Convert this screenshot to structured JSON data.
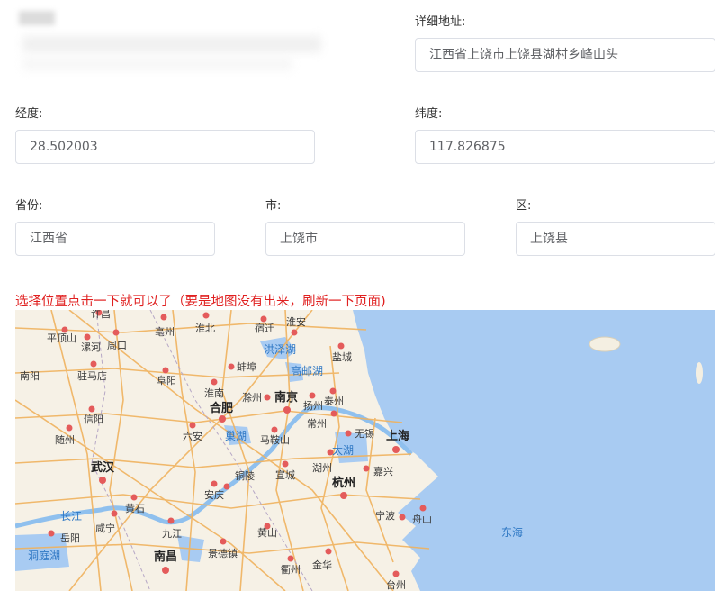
{
  "form": {
    "address_label": "详细地址:",
    "address_value": "江西省上饶市上饶县湖村乡峰山头",
    "lng_label": "经度:",
    "lng_value": "28.502003",
    "lat_label": "纬度:",
    "lat_value": "117.826875",
    "province_label": "省份:",
    "province_value": "江西省",
    "city_label": "市:",
    "city_value": "上饶市",
    "district_label": "区:",
    "district_value": "上饶县"
  },
  "hint": "选择位置点击一下就可以了（要是地图没有出来，刷新一下页面)",
  "map": {
    "cities": [
      "许昌",
      "亳州",
      "淮北",
      "宿迁",
      "淮安",
      "平顶山",
      "漯河",
      "周口",
      "盐城",
      "南阳",
      "驻马店",
      "阜阳",
      "蚌埠",
      "高邮湖",
      "淮南",
      "滁州",
      "南京",
      "扬州",
      "泰州",
      "合肥",
      "信阳",
      "六安",
      "巢湖",
      "马鞍山",
      "常州",
      "无锡",
      "上海",
      "太湖",
      "随州",
      "武汉",
      "铜陵",
      "宣城",
      "湖州",
      "嘉兴",
      "杭州",
      "安庆",
      "黄石",
      "宁波",
      "舟山",
      "长江",
      "咸宁",
      "九江",
      "东海",
      "岳阳",
      "黄山",
      "洞庭湖",
      "南昌",
      "景德镇",
      "衢州",
      "金华",
      "台州",
      "洪泽湖"
    ]
  }
}
